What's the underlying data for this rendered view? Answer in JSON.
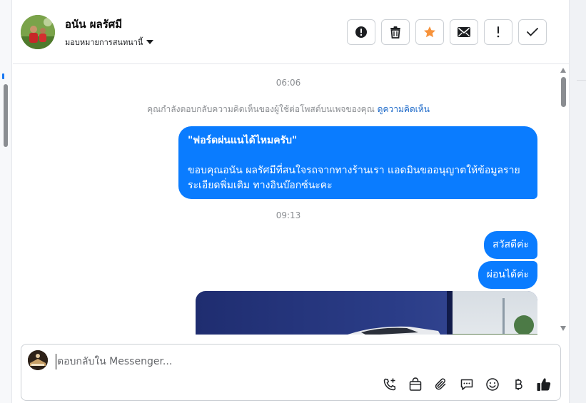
{
  "header": {
    "contact_name": "อนัน ผลรัศมี",
    "assign_label": "มอบหมายการสนทนานี้",
    "actions": [
      {
        "icon": "alert-circle-icon",
        "name": "mark-spam-button"
      },
      {
        "icon": "trash-icon",
        "name": "delete-button"
      },
      {
        "icon": "star-icon",
        "name": "star-button"
      },
      {
        "icon": "envelope-icon",
        "name": "mark-unread-button"
      },
      {
        "icon": "exclamation-icon",
        "name": "follow-up-button"
      },
      {
        "icon": "check-icon",
        "name": "mark-done-button"
      }
    ]
  },
  "thread": {
    "time1": "06:06",
    "notice_text": "คุณกำลังตอบกลับความคิดเห็นของผู้ใช้ต่อโพสต์บนเพจของคุณ",
    "notice_link": "ดูความคิดเห็น",
    "msg1_line1": "\"ฟอร์ดผ่นแนได้ไหมครับ\"",
    "msg1_line2": "ขอบคุณอนัน ผลรัศมีที่สนใจรถจากทางร้านเรา แอดมินขออนุญาตให้ข้อมูลรายระเอียดพิ่มเติม ทางอินบ๊อกซ์นะคะ",
    "time2": "09:13",
    "msg2": "สวัสดีค่ะ",
    "msg3": "ผ่อนได้ค่ะ"
  },
  "composer": {
    "placeholder": "ตอบกลับใน Messenger...",
    "tools": [
      "phone-plus-icon",
      "shopping-bag-icon",
      "paperclip-icon",
      "chat-bubble-icon",
      "smiley-icon",
      "baht-icon",
      "thumbs-up-icon"
    ]
  },
  "colors": {
    "accent": "#0a7cff",
    "star": "#f7923a",
    "link": "#1665c7"
  }
}
